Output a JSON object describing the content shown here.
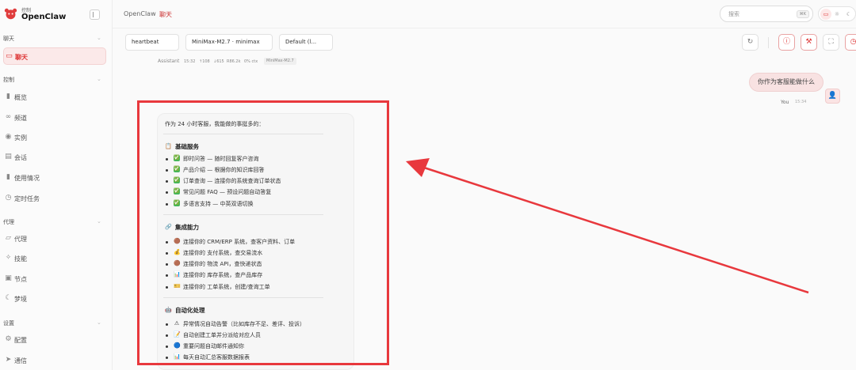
{
  "brand": {
    "small": "控制",
    "name": "OpenClaw"
  },
  "sidebar": {
    "sections": [
      {
        "label": "聊天",
        "items": [
          {
            "label": "聊天",
            "icon": "chat-icon",
            "active": true
          }
        ]
      },
      {
        "label": "控制",
        "items": [
          {
            "label": "概览",
            "icon": "bar-chart-icon"
          },
          {
            "label": "频道",
            "icon": "link-icon"
          },
          {
            "label": "实例",
            "icon": "broadcast-icon"
          },
          {
            "label": "会话",
            "icon": "document-icon"
          },
          {
            "label": "使用情况",
            "icon": "bar-chart-icon"
          },
          {
            "label": "定时任务",
            "icon": "clock-icon"
          }
        ]
      },
      {
        "label": "代理",
        "items": [
          {
            "label": "代理",
            "icon": "folder-icon"
          },
          {
            "label": "技能",
            "icon": "lightning-icon"
          },
          {
            "label": "节点",
            "icon": "monitor-icon"
          },
          {
            "label": "梦境",
            "icon": "moon-icon"
          }
        ]
      },
      {
        "label": "设置",
        "items": [
          {
            "label": "配置",
            "icon": "gear-icon"
          },
          {
            "label": "通信",
            "icon": "send-icon"
          }
        ]
      }
    ]
  },
  "topbar": {
    "breadcrumb": [
      "OpenClaw",
      "聊天"
    ],
    "search_placeholder": "搜索",
    "search_shortcut": "⌘K"
  },
  "session": {
    "session_key": "heartbeat",
    "model": "MiniMax-M2.7 · minimax",
    "thinking": "Default (l..."
  },
  "messages": {
    "user": {
      "text": "你作为客服能做什么",
      "name": "You",
      "time": "15:34"
    },
    "assistant": {
      "name": "Assistant",
      "time": "15:32",
      "stats": [
        "↑108",
        "↓615",
        "R86.2k",
        "0% ctx"
      ],
      "model_badge": "MiniMax-M2.7",
      "intro": "作为 24 小时客服，我能做的事挺多的：",
      "sections": [
        {
          "icon": "📋",
          "title": "基础服务",
          "items": [
            {
              "icon": "✅",
              "text": "即时问答 — 随时回复客户咨询"
            },
            {
              "icon": "✅",
              "text": "产品介绍 — 根据你的知识库回答"
            },
            {
              "icon": "✅",
              "text": "订单查询 — 连接你的系统查询订单状态"
            },
            {
              "icon": "✅",
              "text": "常见问题 FAQ — 预设问题自动答复"
            },
            {
              "icon": "✅",
              "text": "多语言支持 — 中英双语切换"
            }
          ]
        },
        {
          "icon": "🔗",
          "title": "集成能力",
          "items": [
            {
              "icon": "🟤",
              "text": "连接你的 CRM/ERP 系统，查客户资料、订单"
            },
            {
              "icon": "💰",
              "text": "连接你的 支付系统，查交易流水"
            },
            {
              "icon": "🟤",
              "text": "连接你的 物流 API，查快递状态"
            },
            {
              "icon": "📊",
              "text": "连接你的 库存系统，查产品库存"
            },
            {
              "icon": "🎫",
              "text": "连接你的 工单系统，创建/查询工单"
            }
          ]
        },
        {
          "icon": "🤖",
          "title": "自动化处理",
          "items": [
            {
              "icon": "⚠",
              "text": "异常情况自动告警（比如库存不足、差评、投诉）"
            },
            {
              "icon": "📝",
              "text": "自动创建工单并分派给对应人员"
            },
            {
              "icon": "🔵",
              "text": "重要问题自动邮件通知你"
            },
            {
              "icon": "📊",
              "text": "每天自动汇总客服数据报表"
            }
          ]
        }
      ]
    }
  },
  "colors": {
    "accent": "#d33333",
    "annotation": "#e8383d",
    "check": "#42b85a"
  }
}
